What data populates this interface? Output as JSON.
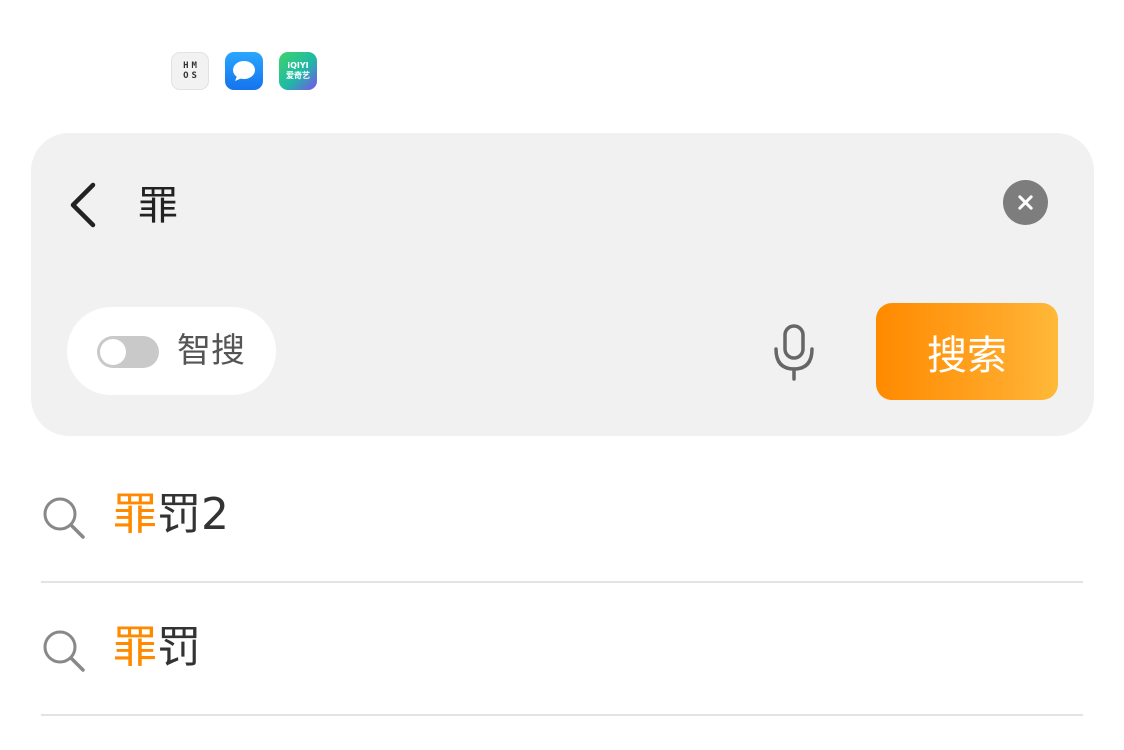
{
  "status_bar": {
    "icons": [
      {
        "name": "hmos-icon",
        "lines": [
          "HM",
          "OS"
        ]
      },
      {
        "name": "messages-icon"
      },
      {
        "name": "iqiyi-icon",
        "lines": [
          "iQIYI",
          "爱奇艺"
        ]
      }
    ]
  },
  "search_bar": {
    "query": "罪",
    "smart_search_label": "智搜",
    "smart_search_enabled": false,
    "search_button_label": "搜索",
    "accent_color": "#ff8a00"
  },
  "suggestions": [
    {
      "highlight": "罪",
      "rest": "罚2"
    },
    {
      "highlight": "罪",
      "rest": "罚"
    }
  ]
}
